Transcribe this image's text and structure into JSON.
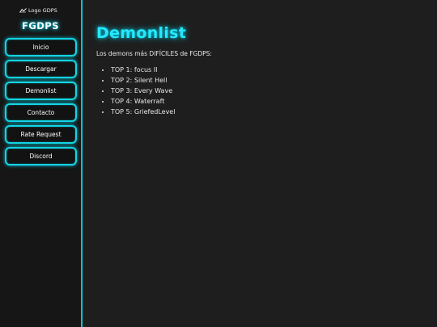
{
  "sidebar": {
    "logo_text": "Logo GDPS",
    "brand": "FGDPS",
    "items": [
      {
        "label": "Inicio"
      },
      {
        "label": "Descargar"
      },
      {
        "label": "Demonlist"
      },
      {
        "label": "Contacto"
      },
      {
        "label": "Rate Request"
      },
      {
        "label": "Discord"
      }
    ]
  },
  "main": {
    "title": "Demonlist",
    "intro": "Los demons más DIFÍCILES de FGDPS:",
    "demons": [
      "TOP 1: focus II",
      "TOP 2: Silent Hell",
      "TOP 3: Every Wave",
      "TOP 4: Waterraft",
      "TOP 5: GriefedLevel"
    ]
  },
  "colors": {
    "accent": "#24e8ff",
    "border": "#14d4e4",
    "background": "#1e1e1e",
    "sidebar_background": "#161616"
  },
  "icons": {
    "logo": "broken-image-icon"
  }
}
